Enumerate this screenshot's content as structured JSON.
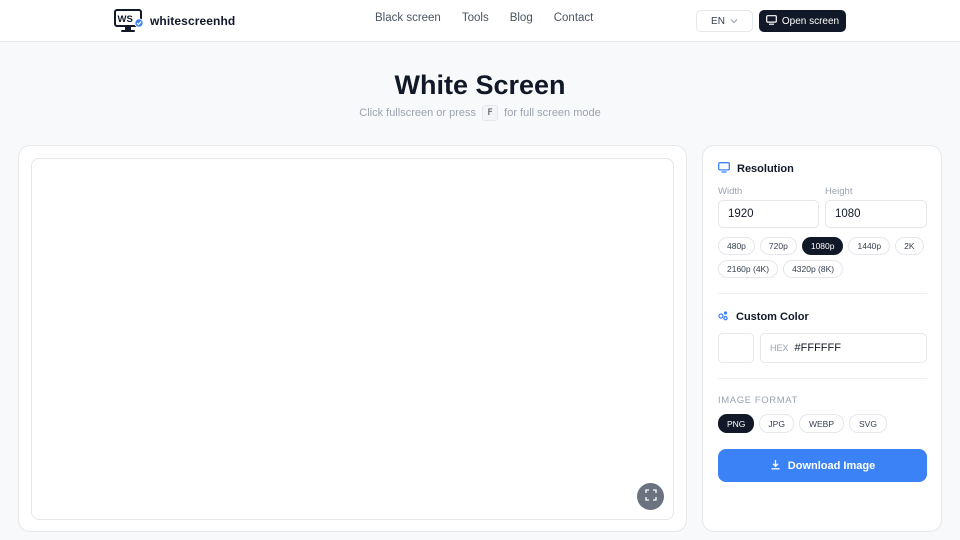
{
  "header": {
    "brand_mark": "WS",
    "brand_name": "whitescreenhd",
    "nav": [
      "Black screen",
      "Tools",
      "Blog",
      "Contact"
    ],
    "language": "EN",
    "open_screen_label": "Open screen"
  },
  "hero": {
    "title": "White Screen",
    "subtitle_before": "Click fullscreen or press",
    "subtitle_key": "F",
    "subtitle_after": "for full screen mode"
  },
  "preview": {
    "background_color": "#FFFFFF",
    "fullscreen_icon": "expand-icon"
  },
  "resolution": {
    "title": "Resolution",
    "width_label": "Width",
    "width_value": "1920",
    "height_label": "Height",
    "height_value": "1080",
    "presets": [
      "480p",
      "720p",
      "1080p",
      "1440p",
      "2K",
      "2160p (4K)",
      "4320p (8K)"
    ],
    "active_preset": "1080p"
  },
  "custom_color": {
    "title": "Custom Color",
    "hex_prefix": "HEX",
    "hex_value": "#FFFFFF",
    "swatch_color": "#FFFFFF"
  },
  "image_format": {
    "title": "IMAGE FORMAT",
    "options": [
      "PNG",
      "JPG",
      "WEBP",
      "SVG"
    ],
    "active": "PNG"
  },
  "download": {
    "label": "Download Image"
  },
  "colors": {
    "accent": "#3B82F6",
    "dark": "#111827"
  }
}
